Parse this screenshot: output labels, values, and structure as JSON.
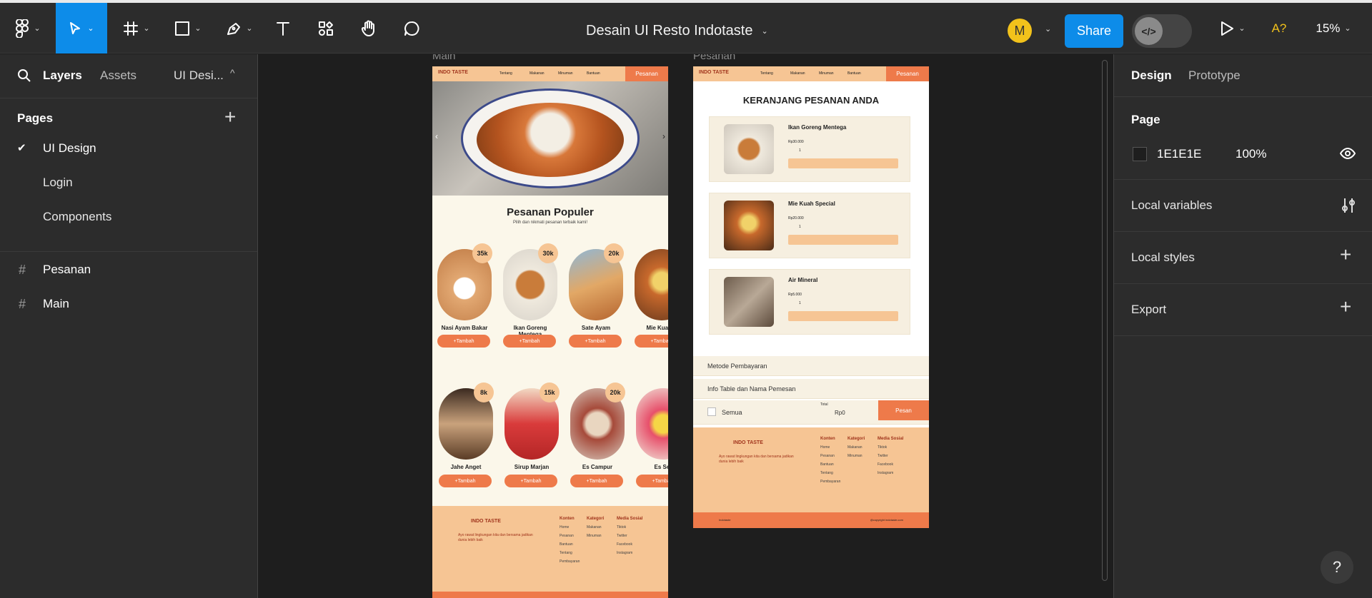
{
  "toolbar": {
    "file_title": "Desain UI Resto Indotaste",
    "avatar_initial": "M",
    "share_label": "Share",
    "ai_label": "A?",
    "zoom": "15%",
    "dev_label": "</>"
  },
  "left_panel": {
    "tabs": [
      "Layers",
      "Assets"
    ],
    "page_selector": "UI Desi...",
    "pages_header": "Pages",
    "pages": [
      "UI Design",
      "Login",
      "Components"
    ],
    "active_page": "UI Design",
    "layers": [
      "Pesanan",
      "Main"
    ]
  },
  "right_panel": {
    "tabs": [
      "Design",
      "Prototype"
    ],
    "page_header": "Page",
    "bg_color": "1E1E1E",
    "opacity": "100%",
    "rows": [
      "Local variables",
      "Local styles",
      "Export"
    ]
  },
  "canvas": {
    "frames": [
      {
        "label": "Main"
      },
      {
        "label": "Pesanan"
      }
    ]
  },
  "main_frame": {
    "logo": "INDO TASTE",
    "nav_links": [
      "Tentang",
      "Makanan",
      "Minuman",
      "Bantuan"
    ],
    "nav_button": "Pesanan",
    "section_title": "Pesanan Populer",
    "section_subtitle": "Pilih dan nikmati pesanan terbaik kami!",
    "items": [
      {
        "name": "Nasi Ayam Bakar",
        "price": "35k"
      },
      {
        "name": "Ikan Goreng Mentega",
        "price": "30k"
      },
      {
        "name": "Sate Ayam",
        "price": "20k"
      },
      {
        "name": "Mie Kuah S",
        "price": ""
      },
      {
        "name": "Jahe Anget",
        "price": "8k"
      },
      {
        "name": "Sirup Marjan",
        "price": "15k"
      },
      {
        "name": "Es Campur",
        "price": "20k"
      },
      {
        "name": "Es Ser",
        "price": ""
      }
    ],
    "add_label": "+Tambah",
    "footer": {
      "logo": "INDO TASTE",
      "tagline": "Ayo rawat lingkungan kita dan bersama jadikan dunia lebih baik",
      "columns": [
        {
          "title": "Konten",
          "items": [
            "Home",
            "Pesanan",
            "Bantuan",
            "Tentang",
            "Pembayaran"
          ]
        },
        {
          "title": "Kategori",
          "items": [
            "Makanan",
            "Minuman"
          ]
        },
        {
          "title": "Media Sosial",
          "items": [
            "Tiktok",
            "Twitter",
            "Facebook",
            "Instagram"
          ]
        }
      ]
    }
  },
  "pesanan_frame": {
    "logo": "INDO TASTE",
    "nav_links": [
      "Tentang",
      "Makanan",
      "Minuman",
      "Bantuan"
    ],
    "nav_button": "Pesanan",
    "cart_title": "KERANJANG PESANAN ANDA",
    "cart_items": [
      {
        "name": "Ikan Goreng Mentega",
        "price": "Rp30.000",
        "qty": "1"
      },
      {
        "name": "Mie Kuah Special",
        "price": "Rp20.000",
        "qty": "1"
      },
      {
        "name": "Air Mineral",
        "price": "Rp5.000",
        "qty": "1"
      }
    ],
    "payment_row": "Metode Pembayaran",
    "info_row": "Info Table dan Nama Pemesan",
    "select_all": "Semua",
    "total_label": "Total",
    "total_value": "Rp0",
    "order_button": "Pesan",
    "footer": {
      "logo": "INDO TASTE",
      "tagline": "Ayo rawat lingkungan kita dan bersama jadikan dunia lebih baik",
      "columns": [
        {
          "title": "Konten",
          "items": [
            "Home",
            "Pesanan",
            "Bantuan",
            "Tentang",
            "Pembayaran"
          ]
        },
        {
          "title": "Kategori",
          "items": [
            "Makanan",
            "Minuman"
          ]
        },
        {
          "title": "Media Sosial",
          "items": [
            "Tiktok",
            "Twitter",
            "Facebook",
            "Instagram"
          ]
        }
      ],
      "bottom_left": "Indotaste",
      "bottom_right": "@copyright indotaste.com"
    }
  },
  "help_label": "?"
}
